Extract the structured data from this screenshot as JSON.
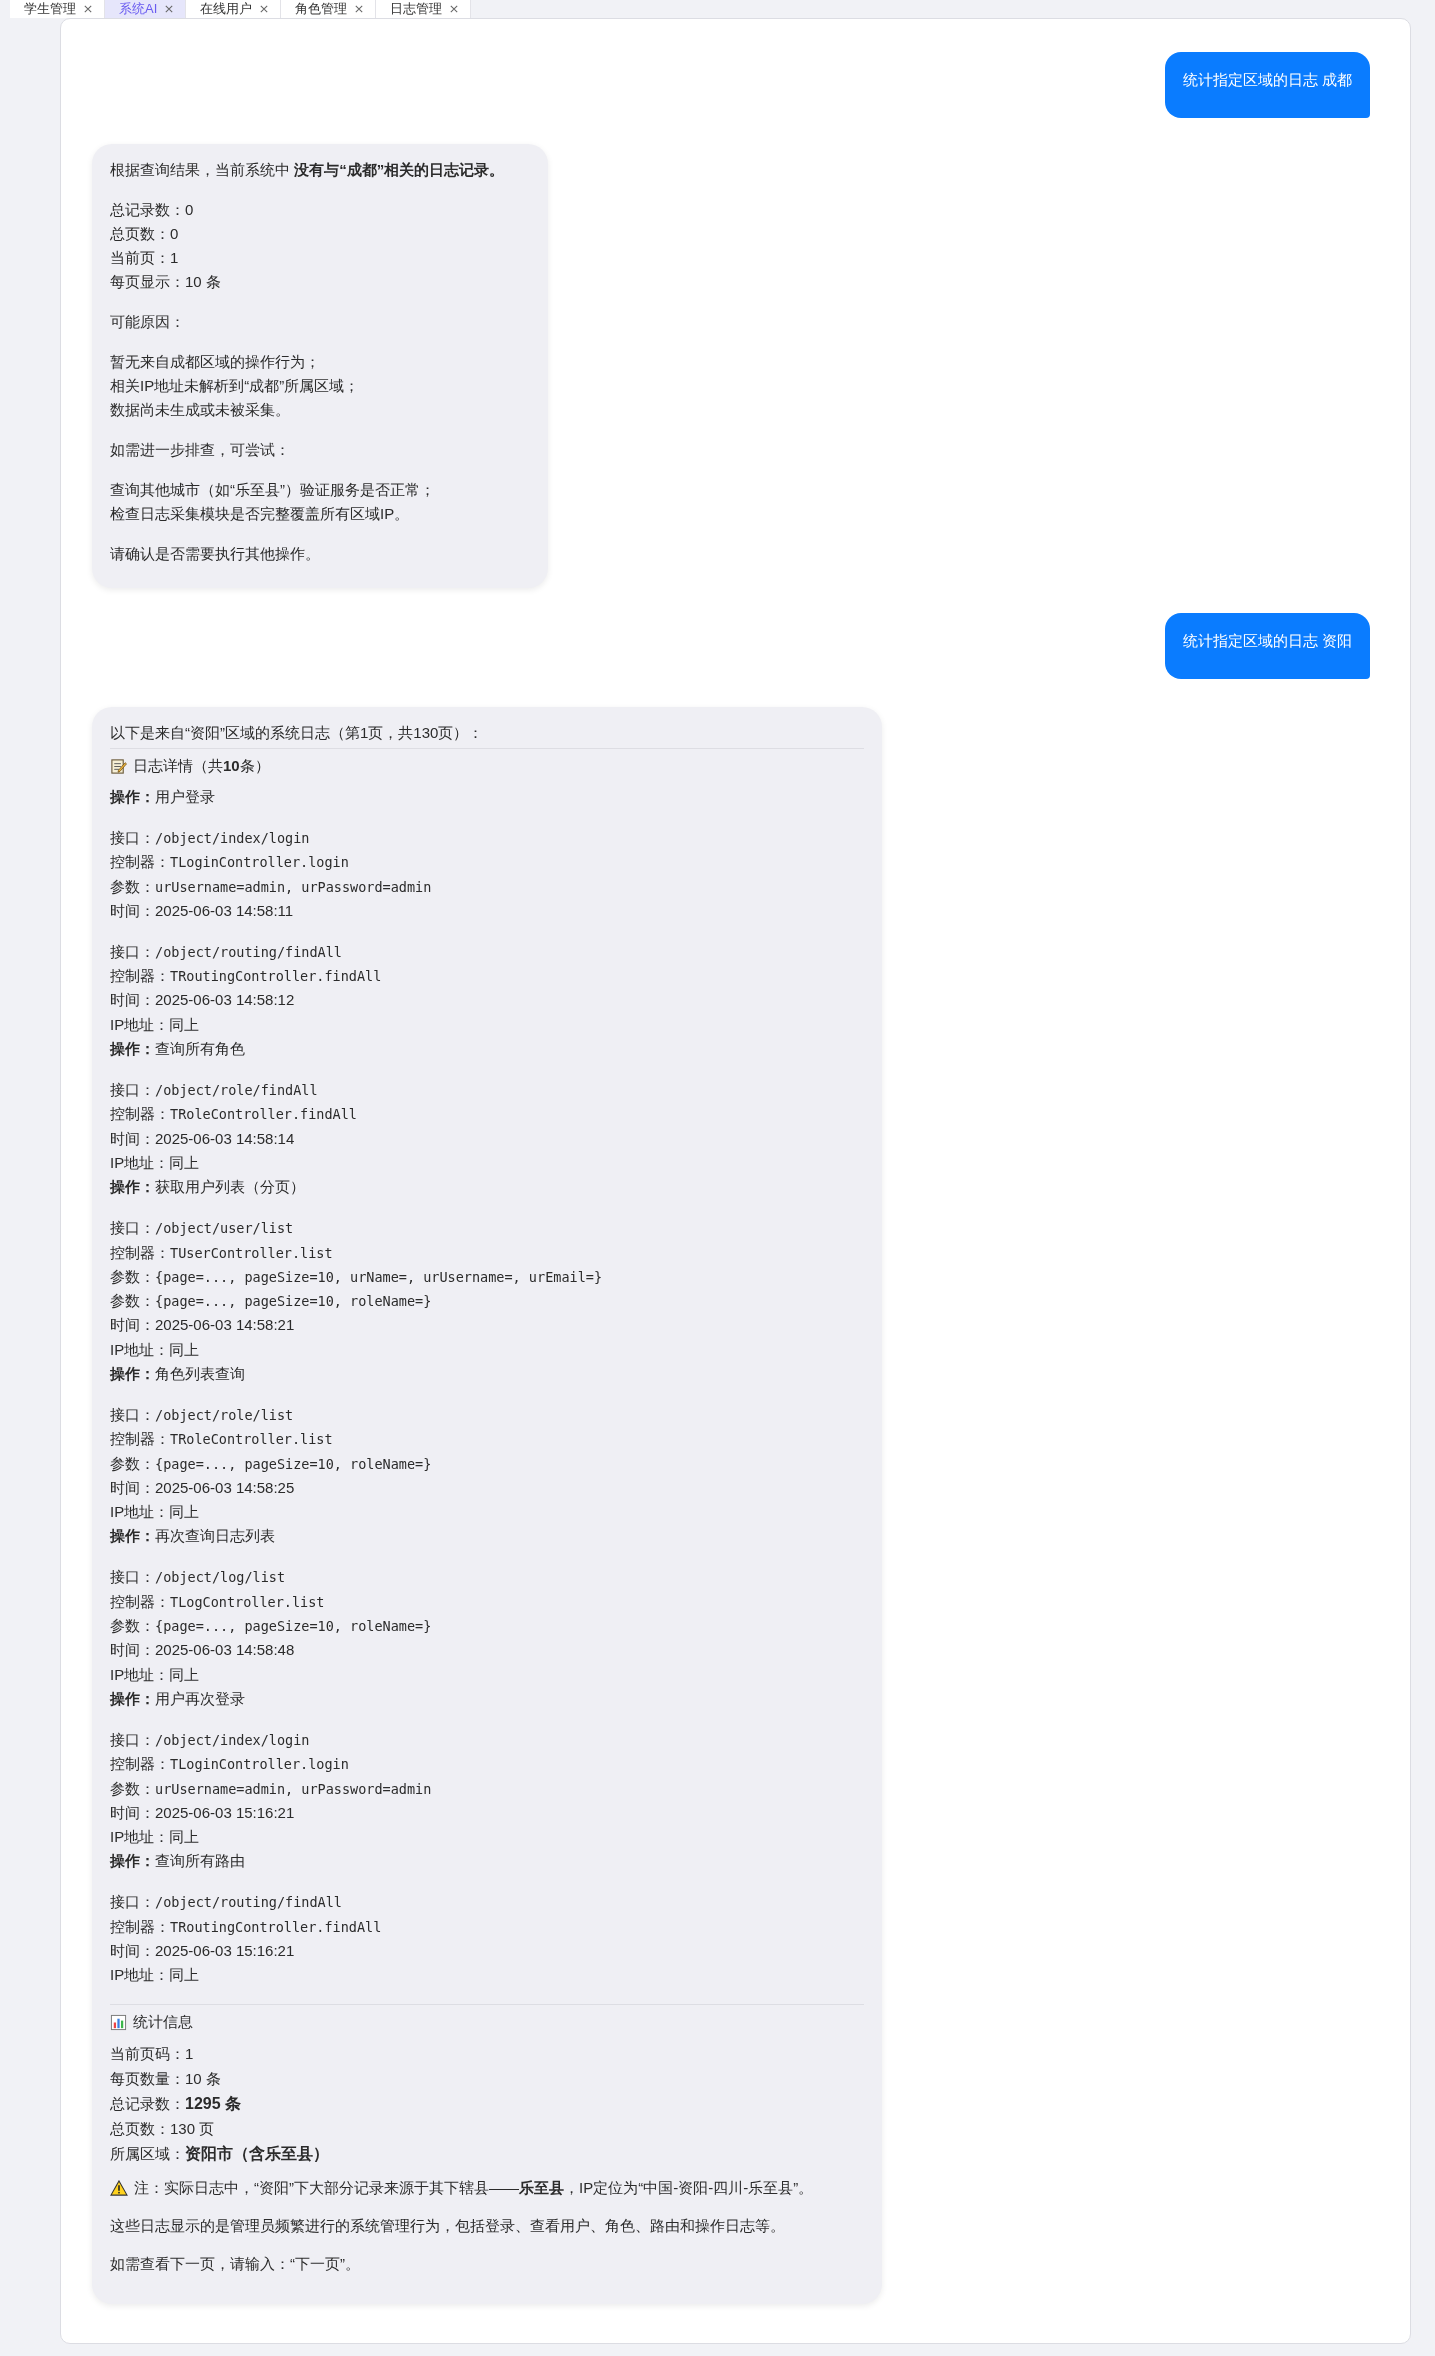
{
  "tabs": [
    {
      "label": "学生管理",
      "selected": false
    },
    {
      "label": "系统AI",
      "selected": true
    },
    {
      "label": "在线用户",
      "selected": false
    },
    {
      "label": "角色管理",
      "selected": false
    },
    {
      "label": "日志管理",
      "selected": false
    }
  ],
  "messages": [
    {
      "kind": "user",
      "text": "统计指定区域的日志 成都"
    },
    {
      "kind": "assistant_text",
      "paragraphs": [
        [
          "根据查询结果，当前系统中 **没有与“成都”相关的日志记录。**"
        ],
        [
          "总记录数：0",
          "总页数：0",
          "当前页：1",
          "每页显示：10 条"
        ],
        [
          "可能原因："
        ],
        [
          "暂无来自成都区域的操作行为；",
          "相关IP地址未解析到“成都”所属区域；",
          "数据尚未生成或未被采集。"
        ],
        [
          "如需进一步排查，可尝试："
        ],
        [
          "查询其他城市（如“乐至县”）验证服务是否正常；",
          "检查日志采集模块是否完整覆盖所有区域IP。"
        ],
        [
          "请确认是否需要执行其他操作。"
        ]
      ]
    },
    {
      "kind": "user",
      "text": "统计指定区域的日志 资阳"
    },
    {
      "kind": "assistant_log",
      "intro": "以下是来自“资阳”区域的系统日志（第1页，共130页）：",
      "details_heading": "日志详情（共**10**条）",
      "blocks": [
        [
          {
            "kind": "op",
            "label": "操作：",
            "value": "用户登录"
          }
        ],
        [
          {
            "kind": "code",
            "label": "接口：",
            "value": "/object/index/login"
          },
          {
            "kind": "code",
            "label": "控制器：",
            "value": "TLoginController.login"
          },
          {
            "kind": "code",
            "label": "参数：",
            "value": "urUsername=admin, urPassword=admin"
          },
          {
            "kind": "plain",
            "label": "时间：",
            "value": "2025-06-03 14:58:11"
          }
        ],
        [
          {
            "kind": "code",
            "label": "接口：",
            "value": "/object/routing/findAll"
          },
          {
            "kind": "code",
            "label": "控制器：",
            "value": "TRoutingController.findAll"
          },
          {
            "kind": "plain",
            "label": "时间：",
            "value": "2025-06-03 14:58:12"
          },
          {
            "kind": "plain",
            "label": "IP地址：",
            "value": "同上"
          },
          {
            "kind": "op",
            "label": "操作：",
            "value": "查询所有角色"
          }
        ],
        [
          {
            "kind": "code",
            "label": "接口：",
            "value": "/object/role/findAll"
          },
          {
            "kind": "code",
            "label": "控制器：",
            "value": "TRoleController.findAll"
          },
          {
            "kind": "plain",
            "label": "时间：",
            "value": "2025-06-03 14:58:14"
          },
          {
            "kind": "plain",
            "label": "IP地址：",
            "value": "同上"
          },
          {
            "kind": "op",
            "label": "操作：",
            "value": "获取用户列表（分页）"
          }
        ],
        [
          {
            "kind": "code",
            "label": "接口：",
            "value": "/object/user/list"
          },
          {
            "kind": "code",
            "label": "控制器：",
            "value": "TUserController.list"
          },
          {
            "kind": "code",
            "label": "参数：",
            "value": "{page=..., pageSize=10, urName=, urUsername=, urEmail=}"
          },
          {
            "kind": "code",
            "label": "参数：",
            "value": "{page=..., pageSize=10, roleName=}"
          },
          {
            "kind": "plain",
            "label": "时间：",
            "value": "2025-06-03 14:58:21"
          },
          {
            "kind": "plain",
            "label": "IP地址：",
            "value": "同上"
          },
          {
            "kind": "op",
            "label": "操作：",
            "value": "角色列表查询"
          }
        ],
        [
          {
            "kind": "code",
            "label": "接口：",
            "value": "/object/role/list"
          },
          {
            "kind": "code",
            "label": "控制器：",
            "value": "TRoleController.list"
          },
          {
            "kind": "code",
            "label": "参数：",
            "value": "{page=..., pageSize=10, roleName=}"
          },
          {
            "kind": "plain",
            "label": "时间：",
            "value": "2025-06-03 14:58:25"
          },
          {
            "kind": "plain",
            "label": "IP地址：",
            "value": "同上"
          },
          {
            "kind": "op",
            "label": "操作：",
            "value": "再次查询日志列表"
          }
        ],
        [
          {
            "kind": "code",
            "label": "接口：",
            "value": "/object/log/list"
          },
          {
            "kind": "code",
            "label": "控制器：",
            "value": "TLogController.list"
          },
          {
            "kind": "code",
            "label": "参数：",
            "value": "{page=..., pageSize=10, roleName=}"
          },
          {
            "kind": "plain",
            "label": "时间：",
            "value": "2025-06-03 14:58:48"
          },
          {
            "kind": "plain",
            "label": "IP地址：",
            "value": "同上"
          },
          {
            "kind": "op",
            "label": "操作：",
            "value": "用户再次登录"
          }
        ],
        [
          {
            "kind": "code",
            "label": "接口：",
            "value": "/object/index/login"
          },
          {
            "kind": "code",
            "label": "控制器：",
            "value": "TLoginController.login"
          },
          {
            "kind": "code",
            "label": "参数：",
            "value": "urUsername=admin, urPassword=admin"
          },
          {
            "kind": "plain",
            "label": "时间：",
            "value": "2025-06-03 15:16:21"
          },
          {
            "kind": "plain",
            "label": "IP地址：",
            "value": "同上"
          },
          {
            "kind": "op",
            "label": "操作：",
            "value": "查询所有路由"
          }
        ],
        [
          {
            "kind": "code",
            "label": "接口：",
            "value": "/object/routing/findAll"
          },
          {
            "kind": "code",
            "label": "控制器：",
            "value": "TRoutingController.findAll"
          },
          {
            "kind": "plain",
            "label": "时间：",
            "value": "2025-06-03 15:16:21"
          },
          {
            "kind": "plain",
            "label": "IP地址：",
            "value": "同上"
          }
        ]
      ],
      "stats_heading": "统计信息",
      "stats": [
        {
          "kind": "plain",
          "label": "当前页码：",
          "value": "1"
        },
        {
          "kind": "plain",
          "label": "每页数量：",
          "value": "10 条"
        },
        {
          "kind": "bold",
          "label": "总记录数：",
          "value": "1295 条"
        },
        {
          "kind": "plain",
          "label": "总页数：",
          "value": "130 页"
        },
        {
          "kind": "bold",
          "label": "所属区域：",
          "value": "资阳市（含乐至县）"
        }
      ],
      "note": "注：实际日志中，“资阳”下大部分记录来源于其下辖县——**乐至县**，IP定位为“中国-资阳-四川-乐至县”。",
      "closing": [
        "这些日志显示的是管理员频繁进行的系统管理行为，包括登录、查看用户、角色、路由和操作日志等。",
        "如需查看下一页，请输入：“下一页”。"
      ]
    }
  ]
}
